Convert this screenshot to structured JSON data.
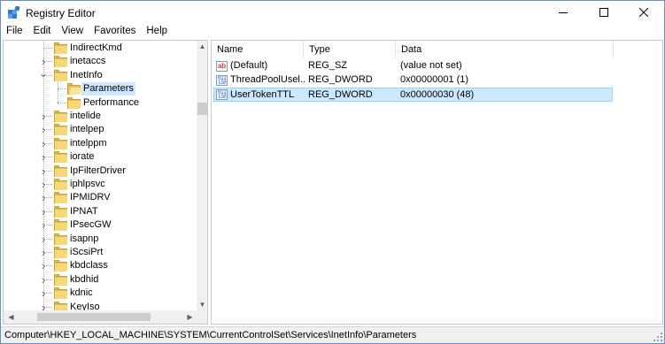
{
  "window": {
    "title": "Registry Editor",
    "icons": {
      "app": "registry-editor-icon",
      "minimize": "minimize-icon",
      "maximize": "maximize-icon",
      "close": "close-icon"
    }
  },
  "menu": [
    "File",
    "Edit",
    "View",
    "Favorites",
    "Help"
  ],
  "tree": {
    "items": [
      {
        "label": "IndirectKmd",
        "expanded": false,
        "selected": false
      },
      {
        "label": "inetaccs",
        "expanded": false,
        "selected": false
      },
      {
        "label": "InetInfo",
        "expanded": true,
        "selected": false
      },
      {
        "label": "Parameters",
        "expanded": false,
        "selected": true
      },
      {
        "label": "Performance",
        "expanded": false,
        "selected": false
      },
      {
        "label": "intelide",
        "expanded": false,
        "selected": false
      },
      {
        "label": "intelpep",
        "expanded": false,
        "selected": false
      },
      {
        "label": "intelppm",
        "expanded": false,
        "selected": false
      },
      {
        "label": "iorate",
        "expanded": false,
        "selected": false
      },
      {
        "label": "IpFilterDriver",
        "expanded": false,
        "selected": false
      },
      {
        "label": "iphlpsvc",
        "expanded": false,
        "selected": false
      },
      {
        "label": "IPMIDRV",
        "expanded": false,
        "selected": false
      },
      {
        "label": "IPNAT",
        "expanded": false,
        "selected": false
      },
      {
        "label": "IPsecGW",
        "expanded": false,
        "selected": false
      },
      {
        "label": "isapnp",
        "expanded": false,
        "selected": false
      },
      {
        "label": "iScsiPrt",
        "expanded": false,
        "selected": false
      },
      {
        "label": "kbdclass",
        "expanded": false,
        "selected": false
      },
      {
        "label": "kbdhid",
        "expanded": false,
        "selected": false
      },
      {
        "label": "kdnic",
        "expanded": false,
        "selected": false
      },
      {
        "label": "KeyIso",
        "expanded": false,
        "selected": false
      }
    ]
  },
  "list": {
    "columns": [
      "Name",
      "Type",
      "Data"
    ],
    "rows": [
      {
        "icon": "string-value-icon",
        "icon_text": "ab",
        "name": "(Default)",
        "type": "REG_SZ",
        "data": "(value not set)",
        "selected": false
      },
      {
        "icon": "binary-value-icon",
        "icon_text": "011\n110",
        "name": "ThreadPoolUsel...",
        "type": "REG_DWORD",
        "data": "0x00000001 (1)",
        "selected": false
      },
      {
        "icon": "binary-value-icon",
        "icon_text": "011\n110",
        "name": "UserTokenTTL",
        "type": "REG_DWORD",
        "data": "0x00000030 (48)",
        "selected": true
      }
    ]
  },
  "status": {
    "path": "Computer\\HKEY_LOCAL_MACHINE\\SYSTEM\\CurrentControlSet\\Services\\InetInfo\\Parameters"
  },
  "colors": {
    "selection": "#cce8ff",
    "selection_border": "#99d1ff",
    "folder": "#f7d876",
    "tree_selection": "#cde8ff"
  }
}
